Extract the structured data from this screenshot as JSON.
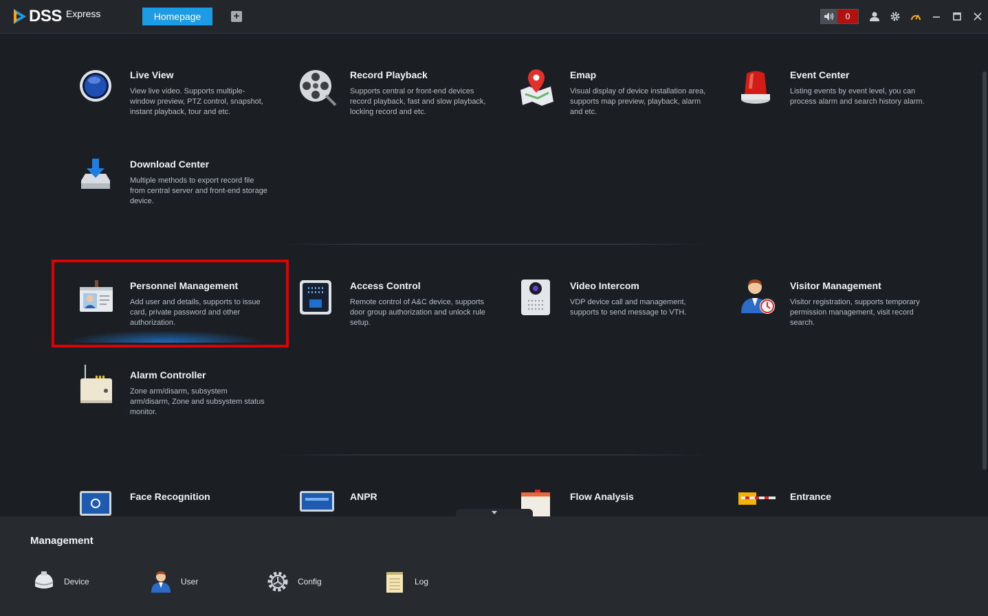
{
  "titlebar": {
    "logo_text": "DSS",
    "logo_sub": "Express",
    "tab_home": "Homepage",
    "tab_add": "+",
    "alarm_count": "0",
    "icons": [
      "speaker-icon",
      "user-icon",
      "gear-icon",
      "speedometer-icon",
      "minimize-icon",
      "maximize-icon",
      "close-icon"
    ]
  },
  "tiles": [
    {
      "title": "Live View",
      "desc": "View live video. Supports multiple-window preview, PTZ control, snapshot, instant playback, tour and etc.",
      "icon": "live-view-icon"
    },
    {
      "title": "Record Playback",
      "desc": "Supports central or front-end devices record playback, fast and slow playback, locking record and etc.",
      "icon": "film-reel-icon"
    },
    {
      "title": "Emap",
      "desc": "Visual display of device installation area, supports map preview, playback, alarm and etc.",
      "icon": "map-pin-icon"
    },
    {
      "title": "Event Center",
      "desc": "Listing events by event level, you can process alarm and search history alarm.",
      "icon": "alarm-light-icon"
    },
    {
      "title": "Download Center",
      "desc": "Multiple methods to export record file from central server and front-end storage device.",
      "icon": "download-icon"
    },
    {
      "title": "Personnel Management",
      "desc": "Add user and details, supports to issue card, private password and other authorization.",
      "icon": "id-card-icon"
    },
    {
      "title": "Access Control",
      "desc": "Remote control of A&C device, supports door group authorization and unlock rule setup.",
      "icon": "access-panel-icon"
    },
    {
      "title": "Video Intercom",
      "desc": "VDP device call and management, supports to send message to VTH.",
      "icon": "intercom-icon"
    },
    {
      "title": "Visitor Management",
      "desc": "Visitor registration, supports temporary permission management, visit record search.",
      "icon": "visitor-icon"
    },
    {
      "title": "Alarm Controller",
      "desc": "Zone arm/disarm, subsystem arm/disarm, Zone and subsystem status monitor.",
      "icon": "alarm-controller-icon"
    },
    {
      "title": "Face Recognition",
      "desc": "",
      "icon": "face-recognition-icon"
    },
    {
      "title": "ANPR",
      "desc": "",
      "icon": "anpr-icon"
    },
    {
      "title": "Flow Analysis",
      "desc": "",
      "icon": "flow-analysis-icon"
    },
    {
      "title": "Entrance",
      "desc": "",
      "icon": "entrance-icon"
    }
  ],
  "management": {
    "title": "Management",
    "items": [
      {
        "label": "Device",
        "icon": "device-icon"
      },
      {
        "label": "User",
        "icon": "user-avatar-icon"
      },
      {
        "label": "Config",
        "icon": "config-gear-icon"
      },
      {
        "label": "Log",
        "icon": "log-notepad-icon"
      }
    ]
  }
}
